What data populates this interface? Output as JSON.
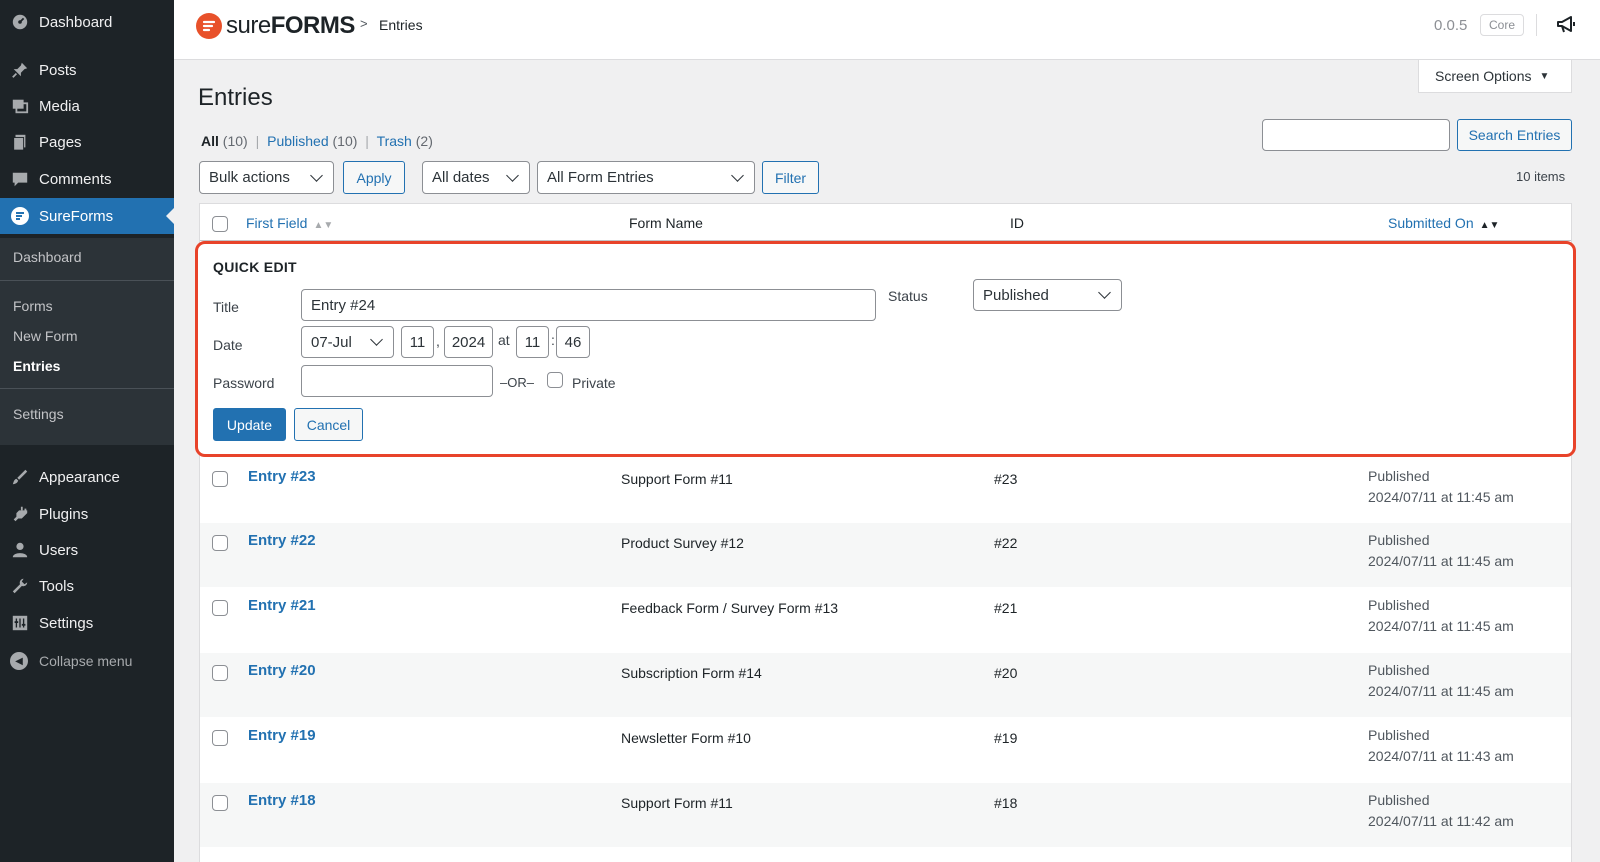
{
  "sidebar": {
    "items": [
      {
        "label": "Dashboard",
        "icon": "dashboard-icon"
      },
      {
        "label": "Posts",
        "icon": "pin-icon"
      },
      {
        "label": "Media",
        "icon": "media-icon"
      },
      {
        "label": "Pages",
        "icon": "pages-icon"
      },
      {
        "label": "Comments",
        "icon": "comment-icon"
      },
      {
        "label": "SureForms",
        "icon": "sureforms-icon"
      }
    ],
    "submenu": {
      "dashboard": "Dashboard",
      "forms": "Forms",
      "new_form": "New Form",
      "entries": "Entries",
      "settings": "Settings"
    },
    "lower_items": [
      {
        "label": "Appearance",
        "icon": "brush-icon"
      },
      {
        "label": "Plugins",
        "icon": "plug-icon"
      },
      {
        "label": "Users",
        "icon": "user-icon"
      },
      {
        "label": "Tools",
        "icon": "wrench-icon"
      },
      {
        "label": "Settings",
        "icon": "settings-icon"
      }
    ],
    "collapse": "Collapse menu"
  },
  "header": {
    "logo_light": "sure",
    "logo_bold": "FORMS",
    "breadcrumb": "Entries",
    "version": "0.0.5",
    "badge": "Core"
  },
  "screen_options": "Screen Options",
  "page_title": "Entries",
  "views": {
    "all": "All",
    "all_count": "(10)",
    "published": "Published",
    "published_count": "(10)",
    "trash": "Trash",
    "trash_count": "(2)"
  },
  "search": {
    "value": "",
    "button": "Search Entries"
  },
  "toolbar": {
    "bulk_actions": "Bulk actions",
    "apply": "Apply",
    "dates": "All dates",
    "form_filter": "All Form Entries",
    "filter": "Filter",
    "items_count": "10 items"
  },
  "table": {
    "headers": {
      "first_field": "First Field",
      "form_name": "Form Name",
      "id": "ID",
      "submitted_on": "Submitted On"
    },
    "rows": [
      {
        "title": "Entry #23",
        "form": "Support Form #11",
        "id": "#23",
        "status": "Published",
        "date": "2024/07/11 at 11:45 am"
      },
      {
        "title": "Entry #22",
        "form": "Product Survey #12",
        "id": "#22",
        "status": "Published",
        "date": "2024/07/11 at 11:45 am"
      },
      {
        "title": "Entry #21",
        "form": "Feedback Form / Survey Form #13",
        "id": "#21",
        "status": "Published",
        "date": "2024/07/11 at 11:45 am"
      },
      {
        "title": "Entry #20",
        "form": "Subscription Form #14",
        "id": "#20",
        "status": "Published",
        "date": "2024/07/11 at 11:45 am"
      },
      {
        "title": "Entry #19",
        "form": "Newsletter Form #10",
        "id": "#19",
        "status": "Published",
        "date": "2024/07/11 at 11:43 am"
      },
      {
        "title": "Entry #18",
        "form": "Support Form #11",
        "id": "#18",
        "status": "Published",
        "date": "2024/07/11 at 11:42 am"
      }
    ]
  },
  "quick_edit": {
    "heading": "QUICK EDIT",
    "title_label": "Title",
    "title_value": "Entry #24",
    "status_label": "Status",
    "status_value": "Published",
    "date_label": "Date",
    "month": "07-Jul",
    "day": "11",
    "comma": ",",
    "year": "2024",
    "at": "at",
    "hour": "11",
    "colon": ":",
    "minute": "46",
    "password_label": "Password",
    "password_value": "",
    "or": "–OR–",
    "private_label": "Private",
    "update": "Update",
    "cancel": "Cancel"
  },
  "colors": {
    "sidebar_bg": "#1d2327",
    "accent": "#2271b1",
    "highlight_border": "#e8432a",
    "brand": "#e8512a"
  }
}
